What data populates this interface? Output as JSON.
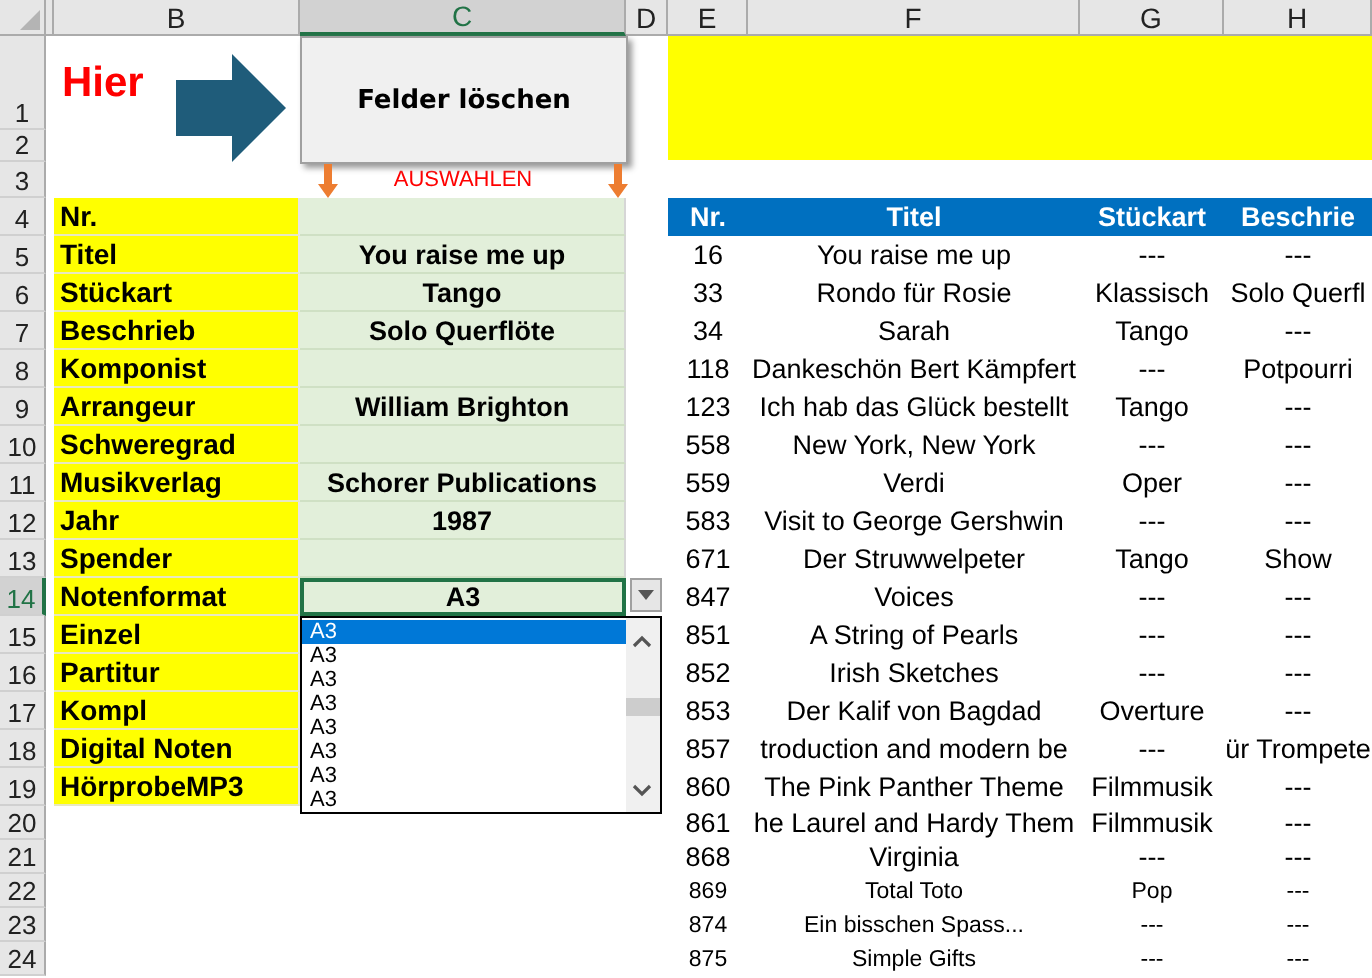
{
  "column_headers": [
    {
      "label": "B",
      "selected": false
    },
    {
      "label": "C",
      "selected": true
    },
    {
      "label": "D",
      "selected": false
    },
    {
      "label": "E",
      "selected": false
    },
    {
      "label": "F",
      "selected": false
    },
    {
      "label": "G",
      "selected": false
    },
    {
      "label": "H",
      "selected": false
    }
  ],
  "row_headers": [
    "1",
    "2",
    "3",
    "4",
    "5",
    "6",
    "7",
    "8",
    "9",
    "10",
    "11",
    "12",
    "13",
    "14",
    "15",
    "16",
    "17",
    "18",
    "19",
    "20",
    "21",
    "22",
    "23",
    "24"
  ],
  "hier_label": "Hier",
  "clear_button": "Felder löschen",
  "select_hint": "AUSWAHLEN",
  "form": [
    {
      "label": "Nr.",
      "kind": "text"
    },
    {
      "label": "Titel",
      "value": "You raise me up",
      "kind": "text"
    },
    {
      "label": "Stückart",
      "value": "Tango",
      "kind": "text"
    },
    {
      "label": "Beschrieb",
      "value": "Solo Querflöte",
      "kind": "text"
    },
    {
      "label": "Komponist",
      "kind": "text"
    },
    {
      "label": "Arrangeur",
      "value": "William Brighton",
      "kind": "text"
    },
    {
      "label": "Schweregrad",
      "kind": "text"
    },
    {
      "label": "Musikverlag",
      "value": "Schorer Publications",
      "kind": "text"
    },
    {
      "label": "Jahr",
      "value": "1987",
      "kind": "text"
    },
    {
      "label": "Spender",
      "kind": "text"
    },
    {
      "label": "Notenformat",
      "value": "A3",
      "kind": "dropdown"
    },
    {
      "label": "Einzel",
      "kind": "text"
    },
    {
      "label": "Partitur",
      "kind": "text"
    },
    {
      "label": "Kompl",
      "kind": "text"
    },
    {
      "label": "Digital Noten",
      "kind": "text"
    },
    {
      "label": "HörprobeMP3",
      "kind": "text"
    }
  ],
  "dropdown_options": [
    {
      "label": "A3",
      "selected": true
    },
    {
      "label": "A3",
      "selected": false
    },
    {
      "label": "A3",
      "selected": false
    },
    {
      "label": "A3",
      "selected": false
    },
    {
      "label": "A3",
      "selected": false
    },
    {
      "label": "A3",
      "selected": false
    },
    {
      "label": "A3",
      "selected": false
    },
    {
      "label": "A3",
      "selected": false
    }
  ],
  "catalog": {
    "columns": [
      "Nr.",
      "Titel",
      "Stückart",
      "Beschrie"
    ],
    "rows": [
      {
        "cells": [
          "16",
          "You raise me up",
          "---",
          "---"
        ],
        "small": false
      },
      {
        "cells": [
          "33",
          "Rondo für Rosie",
          "Klassisch",
          "Solo Querfl"
        ],
        "small": false
      },
      {
        "cells": [
          "34",
          "Sarah",
          "Tango",
          "---"
        ],
        "small": false
      },
      {
        "cells": [
          "118",
          "Dankeschön Bert Kämpfert",
          "---",
          "Potpourri"
        ],
        "small": false
      },
      {
        "cells": [
          "123",
          "Ich hab das Glück bestellt",
          "Tango",
          "---"
        ],
        "small": false
      },
      {
        "cells": [
          "558",
          "New York, New York",
          "---",
          "---"
        ],
        "small": false
      },
      {
        "cells": [
          "559",
          "Verdi",
          "Oper",
          "---"
        ],
        "small": false
      },
      {
        "cells": [
          "583",
          "Visit to George Gershwin",
          "---",
          "---"
        ],
        "small": false
      },
      {
        "cells": [
          "671",
          "Der Struwwelpeter",
          "Tango",
          "Show"
        ],
        "small": false
      },
      {
        "cells": [
          "847",
          "Voices",
          "---",
          "---"
        ],
        "small": false
      },
      {
        "cells": [
          "851",
          "A String of Pearls",
          "---",
          "---"
        ],
        "small": false
      },
      {
        "cells": [
          "852",
          "Irish Sketches",
          "---",
          "---"
        ],
        "small": false
      },
      {
        "cells": [
          "853",
          "Der Kalif von Bagdad",
          "Overture",
          "---"
        ],
        "small": false
      },
      {
        "cells": [
          "857",
          "troduction and modern be",
          "---",
          "ür Trompete"
        ],
        "small": false
      },
      {
        "cells": [
          "860",
          "The Pink Panther Theme",
          "Filmmusik",
          "---"
        ],
        "small": false
      },
      {
        "cells": [
          "861",
          "he Laurel and Hardy Them",
          "Filmmusik",
          "---"
        ],
        "small": false
      },
      {
        "cells": [
          "868",
          "Virginia",
          "---",
          "---"
        ],
        "small": false
      },
      {
        "cells": [
          "869",
          "Total Toto",
          "Pop",
          "---"
        ],
        "small": true
      },
      {
        "cells": [
          "874",
          "Ein bisschen Spass...",
          "---",
          "---"
        ],
        "small": true
      },
      {
        "cells": [
          "875",
          "Simple Gifts",
          "---",
          "---"
        ],
        "small": true
      }
    ]
  }
}
